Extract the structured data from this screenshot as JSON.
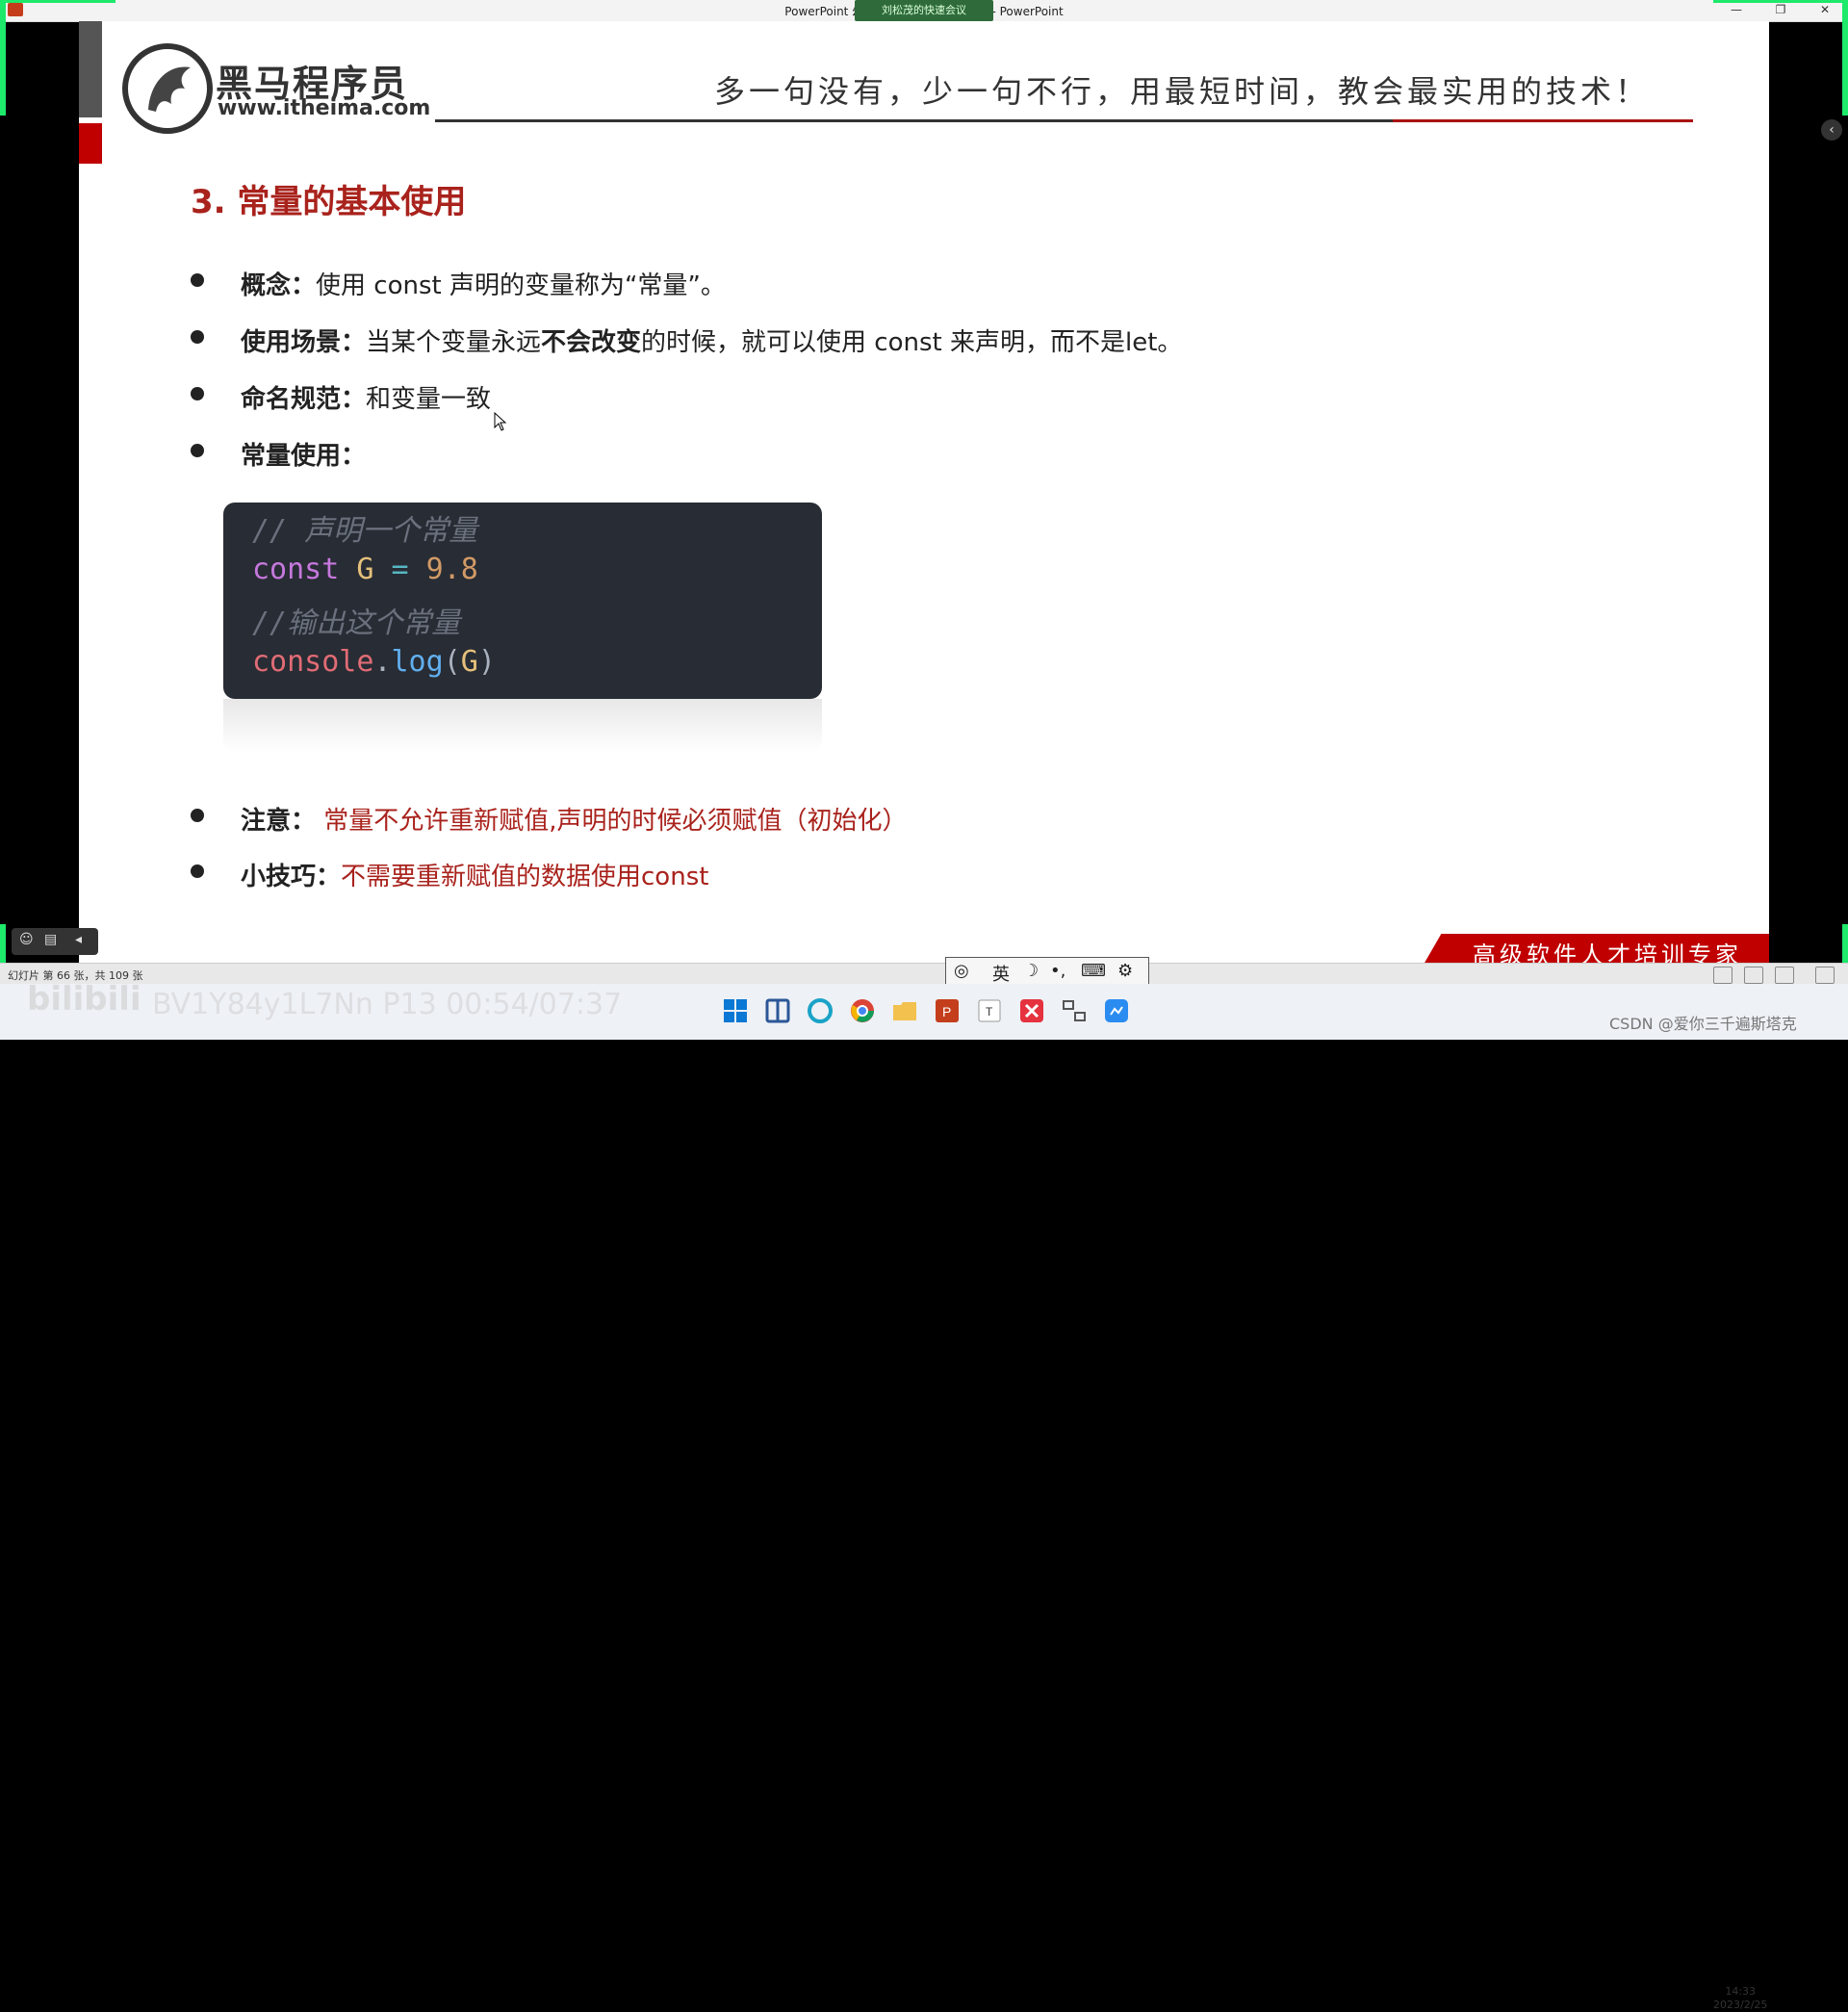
{
  "window": {
    "title": "PowerPoint 幻灯片放映 - [JavaScript] - PowerPoint",
    "meeting_badge": "刘松茂的快速会议",
    "minimize": "—",
    "restore": "❐",
    "close": "✕"
  },
  "slide": {
    "brand_name": "黑马程序员",
    "brand_url": "www.itheima.com",
    "slogan": "多一句没有，少一句不行，用最短时间，教会最实用的技术！",
    "section_title": "3. 常量的基本使用",
    "bullets": [
      {
        "label": "概念：",
        "text": "使用 const 声明的变量称为“常量”。"
      },
      {
        "label": "使用场景：",
        "text_before": "当某个变量永远",
        "bold": "不会改变",
        "text_after": "的时候，就可以使用 const 来声明，而不是let。"
      },
      {
        "label": "命名规范：",
        "text": "和变量一致"
      },
      {
        "label": "常量使用：",
        "text": ""
      },
      {
        "label": "注意：",
        "text": " 常量不允许重新赋值,声明的时候必须赋值（初始化）"
      },
      {
        "label": "小技巧：",
        "text": "不需要重新赋值的数据使用const"
      }
    ],
    "code": {
      "comment1": "// 声明一个常量",
      "kw": "const",
      "var": "G",
      "op": "=",
      "num": "9.8",
      "comment2": "//输出这个常量",
      "obj": "console",
      "dot": ".",
      "fn": "log",
      "paren_open": "(",
      "arg": "G",
      "paren_close": ")"
    },
    "footer_banner": "高级软件人才培训专家"
  },
  "statusbar": {
    "slide_count": "幻灯片 第 66 张，共 109 张"
  },
  "ime": {
    "lang": "英",
    "moon": "☽",
    "punct": "•,",
    "keyboard": "⌨",
    "settings": "⚙"
  },
  "overlay": {
    "bilibili": "bilibili",
    "bv": "BV1Y84y1L7Nn P13 00:54/07:37",
    "csdn": "CSDN @爱你三千遍斯塔克",
    "clock_time": "14:33",
    "clock_date": "2023/2/25"
  }
}
